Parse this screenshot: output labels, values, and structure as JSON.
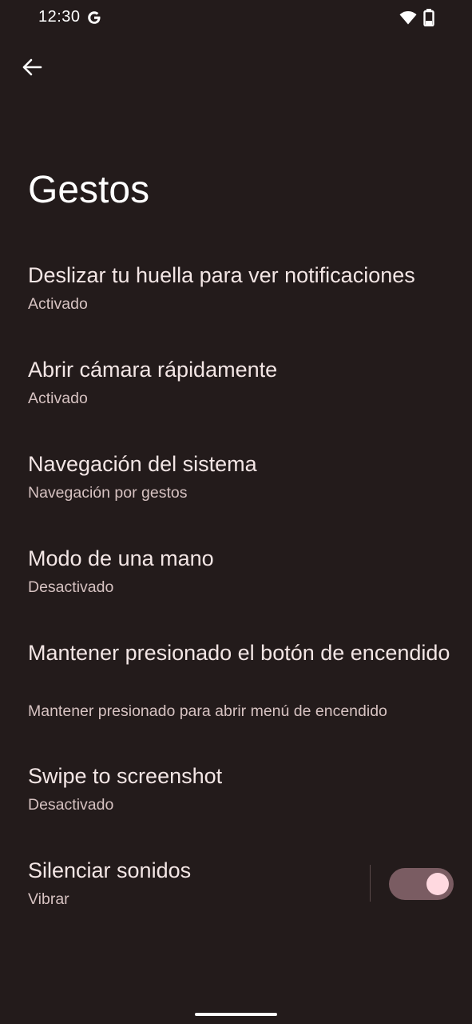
{
  "status_bar": {
    "time": "12:30",
    "icons": [
      "google-g-icon",
      "wifi-icon",
      "battery-icon"
    ]
  },
  "toolbar": {
    "back_icon": "arrow-back-icon"
  },
  "page": {
    "title": "Gestos"
  },
  "settings": [
    {
      "title": "Deslizar tu huella para ver notificaciones",
      "summary": "Activado"
    },
    {
      "title": "Abrir cámara rápidamente",
      "summary": "Activado"
    },
    {
      "title": "Navegación del sistema",
      "summary": "Navegación por gestos"
    },
    {
      "title": "Modo de una mano",
      "summary": "Desactivado"
    },
    {
      "title": "Mantener presionado el botón de encendido",
      "summary": "Mantener presionado para abrir menú de encendido"
    },
    {
      "title": "Swipe to screenshot",
      "summary": "Desactivado"
    },
    {
      "title": "Silenciar sonidos",
      "summary": "Vibrar",
      "toggle_on": true
    }
  ],
  "colors": {
    "background": "#231b1b",
    "toggle_track": "#7a5c62",
    "toggle_thumb": "#ffd9e0"
  }
}
